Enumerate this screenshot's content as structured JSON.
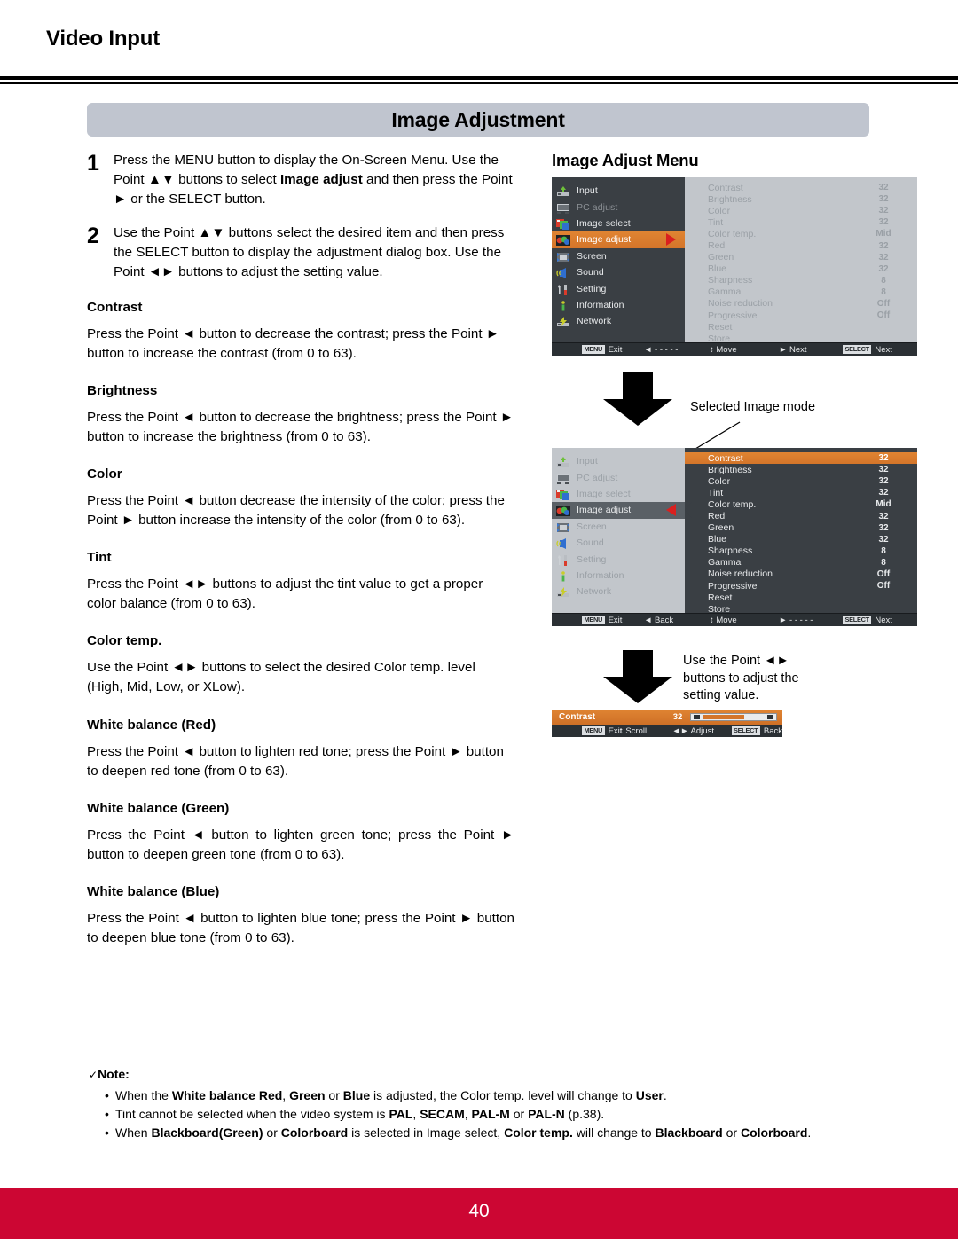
{
  "header": {
    "section_title": "Video Input"
  },
  "banner": {
    "title": "Image Adjustment"
  },
  "steps": [
    {
      "num": "1",
      "html": "Press the MENU button to display the On-Screen Menu. Use the Point ▲▼ buttons to select <b>Image adjust</b> and then press the Point ► or the SELECT button."
    },
    {
      "num": "2",
      "html": "Use the Point ▲▼ buttons select the desired item and then press the SELECT button to display the adjustment dialog box. Use the Point ◄► buttons to adjust the setting value."
    }
  ],
  "sections": [
    {
      "heading": "Contrast",
      "body": "Press the Point ◄ button to decrease the contrast; press the Point ► button to increase the contrast (from 0 to 63)."
    },
    {
      "heading": "Brightness",
      "body": "Press the Point ◄ button to decrease the brightness; press the Point ► button to increase the brightness (from 0 to 63)."
    },
    {
      "heading": "Color",
      "body": "Press the Point ◄ button decrease the intensity of the color; press the Point ► button increase the intensity of the color (from 0 to 63)."
    },
    {
      "heading": "Tint",
      "body": "Press the Point ◄► buttons to adjust the tint value to get a proper color balance (from 0 to 63)."
    },
    {
      "heading": "Color temp.",
      "body": "Use the Point ◄► buttons to select the desired Color temp. level (High, Mid, Low, or XLow)."
    },
    {
      "heading": "White balance (Red)",
      "body": "Press the Point ◄ button to lighten red tone; press the Point ► button to deepen red tone (from 0 to 63)."
    },
    {
      "heading": "White balance (Green)",
      "body": "Press the Point ◄ button to lighten green tone; press the Point ► button to deepen green tone (from 0 to 63)."
    },
    {
      "heading": "White balance (Blue)",
      "body": "Press the Point ◄ button to lighten blue tone; press the Point ► button to deepen blue tone (from 0 to 63)."
    }
  ],
  "note": {
    "check": "✓",
    "title": "Note:",
    "items": [
      "When the <b>White balance Red</b>, <b>Green</b> or <b>Blue</b> is adjusted, the Color temp. level will change to <b>User</b>.",
      "Tint cannot be selected when the video system is <b>PAL</b>, <b>SECAM</b>, <b>PAL-M</b> or <b>PAL-N</b> (p.38).",
      "When <b>Blackboard(Green)</b> or <b>Colorboard</b> is selected in Image select, <b>Color temp.</b> will change to <b>Blackboard</b> or <b>Colorboard</b>."
    ]
  },
  "right": {
    "menu_title": "Image Adjust Menu",
    "selected_image_mode_label": "Selected Image mode",
    "adjust_callout": "Use the Point ◄►\nbuttons to adjust the\nsetting value.",
    "sidebar_items": [
      {
        "label": "Input",
        "icon": "input-icon"
      },
      {
        "label": "PC adjust",
        "icon": "monitor-icon"
      },
      {
        "label": "Image select",
        "icon": "image-select-icon"
      },
      {
        "label": "Image adjust",
        "icon": "image-adjust-icon"
      },
      {
        "label": "Screen",
        "icon": "screen-icon"
      },
      {
        "label": "Sound",
        "icon": "speaker-icon"
      },
      {
        "label": "Setting",
        "icon": "tools-icon"
      },
      {
        "label": "Information",
        "icon": "info-icon"
      },
      {
        "label": "Network",
        "icon": "network-icon"
      }
    ],
    "selected_sidebar_index": 3,
    "settings": [
      {
        "name": "Contrast",
        "value": "32"
      },
      {
        "name": "Brightness",
        "value": "32"
      },
      {
        "name": "Color",
        "value": "32"
      },
      {
        "name": "Tint",
        "value": "32"
      },
      {
        "name": "Color temp.",
        "value": "Mid"
      },
      {
        "name": "Red",
        "value": "32"
      },
      {
        "name": "Green",
        "value": "32"
      },
      {
        "name": "Blue",
        "value": "32"
      },
      {
        "name": "Sharpness",
        "value": "8"
      },
      {
        "name": "Gamma",
        "value": "8"
      },
      {
        "name": "Noise reduction",
        "value": "Off"
      },
      {
        "name": "Progressive",
        "value": "Off"
      },
      {
        "name": "Reset",
        "value": ""
      },
      {
        "name": "Store",
        "value": ""
      }
    ],
    "statusbar_1": [
      {
        "key": "MENU",
        "label": "Exit"
      },
      {
        "key": "",
        "label": "◄ - - - - -"
      },
      {
        "key": "",
        "label": "↕ Move"
      },
      {
        "key": "",
        "label": "► Next"
      },
      {
        "key": "SELECT",
        "label": "Next"
      }
    ],
    "statusbar_2": [
      {
        "key": "MENU",
        "label": "Exit"
      },
      {
        "key": "",
        "label": "◄ Back"
      },
      {
        "key": "",
        "label": "↕ Move"
      },
      {
        "key": "",
        "label": "► - - - - -"
      },
      {
        "key": "SELECT",
        "label": "Next"
      }
    ],
    "dialog": {
      "name": "Contrast",
      "value": "32",
      "statusbar": [
        {
          "key": "MENU",
          "label": "Exit"
        },
        {
          "key": "",
          "label": "↕ Scroll"
        },
        {
          "key": "",
          "label": "◄► Adjust"
        },
        {
          "key": "SELECT",
          "label": "Back"
        }
      ]
    }
  },
  "footer": {
    "page_number": "40"
  },
  "colors": {
    "footer_red": "#cc0633",
    "banner_grey": "#c0c5cf",
    "osd_dark": "#3a3f44",
    "osd_light": "#c2c6cb",
    "highlight_orange": "#d4752a",
    "arrow_red": "#d9201f"
  }
}
